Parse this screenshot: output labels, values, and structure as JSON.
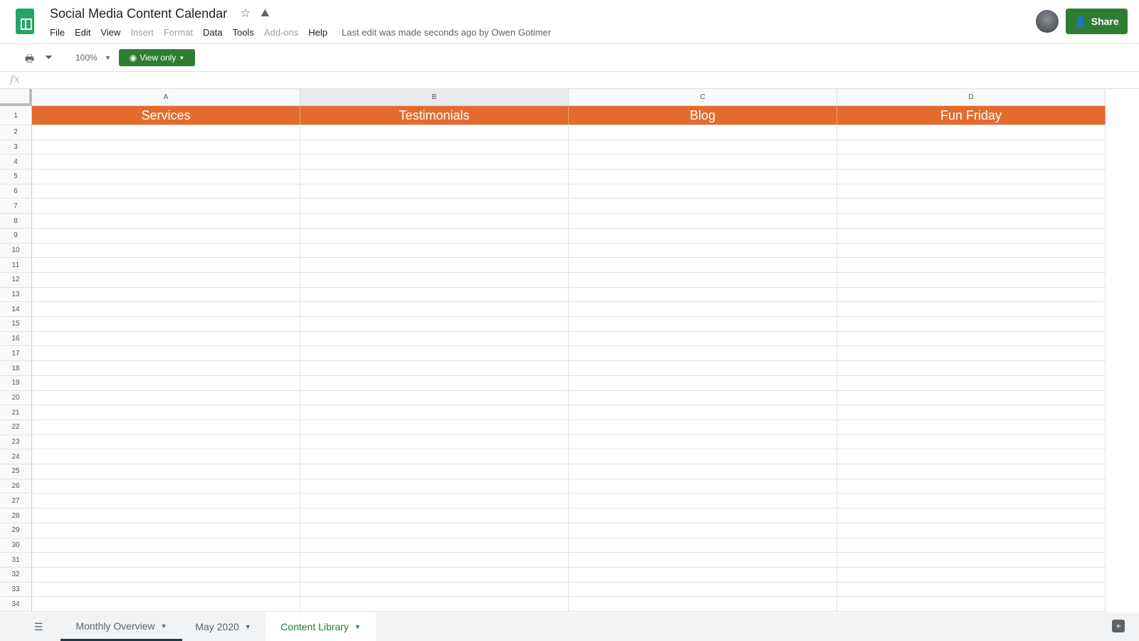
{
  "doc": {
    "title": "Social Media Content Calendar",
    "last_edit": "Last edit was made seconds ago by Owen Gotimer"
  },
  "menu": [
    {
      "label": "File",
      "enabled": true
    },
    {
      "label": "Edit",
      "enabled": true
    },
    {
      "label": "View",
      "enabled": true
    },
    {
      "label": "Insert",
      "enabled": false
    },
    {
      "label": "Format",
      "enabled": false
    },
    {
      "label": "Data",
      "enabled": true
    },
    {
      "label": "Tools",
      "enabled": true
    },
    {
      "label": "Add-ons",
      "enabled": false
    },
    {
      "label": "Help",
      "enabled": true
    }
  ],
  "share": {
    "label": "Share"
  },
  "toolbar": {
    "zoom": "100%",
    "view_only": "View only"
  },
  "formula_bar": {
    "fx": "fx"
  },
  "columns": [
    "A",
    "B",
    "C",
    "D"
  ],
  "selected_column": "B",
  "header_row": [
    "Services",
    "Testimonials",
    "Blog",
    "Fun Friday"
  ],
  "header_color": "#e36c2d",
  "row_numbers": [
    "1",
    "2",
    "3",
    "4",
    "5",
    "6",
    "7",
    "8",
    "9",
    "10",
    "11",
    "12",
    "13",
    "14",
    "15",
    "16",
    "17",
    "18",
    "19",
    "20",
    "21",
    "22",
    "23",
    "24",
    "25",
    "26",
    "27",
    "28",
    "29",
    "30",
    "31",
    "32",
    "33",
    "34"
  ],
  "sheets": [
    {
      "label": "Monthly Overview",
      "active": false
    },
    {
      "label": "May 2020",
      "active": false
    },
    {
      "label": "Content Library",
      "active": true
    }
  ]
}
